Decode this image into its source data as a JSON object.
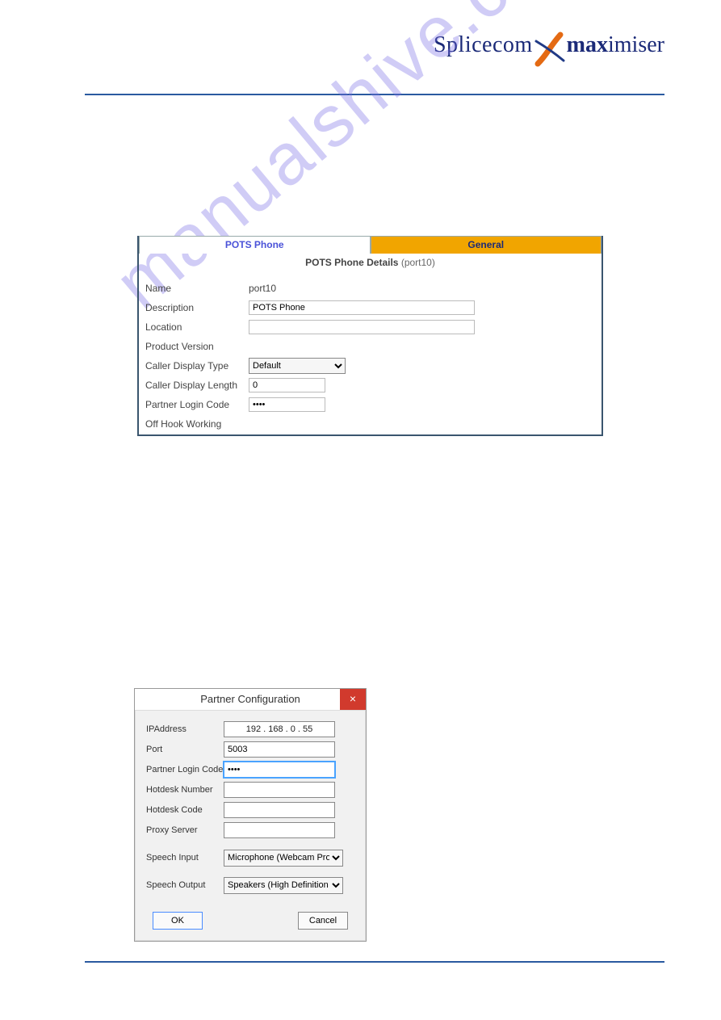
{
  "brand": {
    "splice": "Splicecom",
    "max": "max",
    "imiser": "imiser"
  },
  "watermark": "manualshive.com",
  "pots": {
    "tabs": {
      "active": "POTS Phone",
      "other": "General"
    },
    "title_bold": "POTS Phone Details",
    "title_suffix": "(port10)",
    "rows": {
      "name": {
        "label": "Name",
        "value": "port10"
      },
      "description": {
        "label": "Description",
        "value": "POTS Phone"
      },
      "location": {
        "label": "Location",
        "value": ""
      },
      "product_version": {
        "label": "Product Version",
        "value": ""
      },
      "caller_display_type": {
        "label": "Caller Display Type",
        "selected": "Default"
      },
      "caller_display_length": {
        "label": "Caller Display Length",
        "value": "0"
      },
      "partner_login_code": {
        "label": "Partner Login Code",
        "value": "••••"
      },
      "off_hook": {
        "label": "Off Hook Working"
      }
    }
  },
  "pc": {
    "title": "Partner Configuration",
    "close": "×",
    "rows": {
      "ip": {
        "label": "IPAddress",
        "value": "192 . 168 .   0   .  55"
      },
      "port": {
        "label": "Port",
        "value": "5003"
      },
      "plc": {
        "label": "Partner Login Code",
        "value": "••••"
      },
      "hotdesk_number": {
        "label": "Hotdesk Number",
        "value": ""
      },
      "hotdesk_code": {
        "label": "Hotdesk Code",
        "value": ""
      },
      "proxy": {
        "label": "Proxy Server",
        "value": ""
      },
      "speech_input": {
        "label": "Speech Input",
        "selected": "Microphone (Webcam Pro"
      },
      "speech_output": {
        "label": "Speech Output",
        "selected": "Speakers (High Definition"
      }
    },
    "buttons": {
      "ok": "OK",
      "cancel": "Cancel"
    }
  }
}
